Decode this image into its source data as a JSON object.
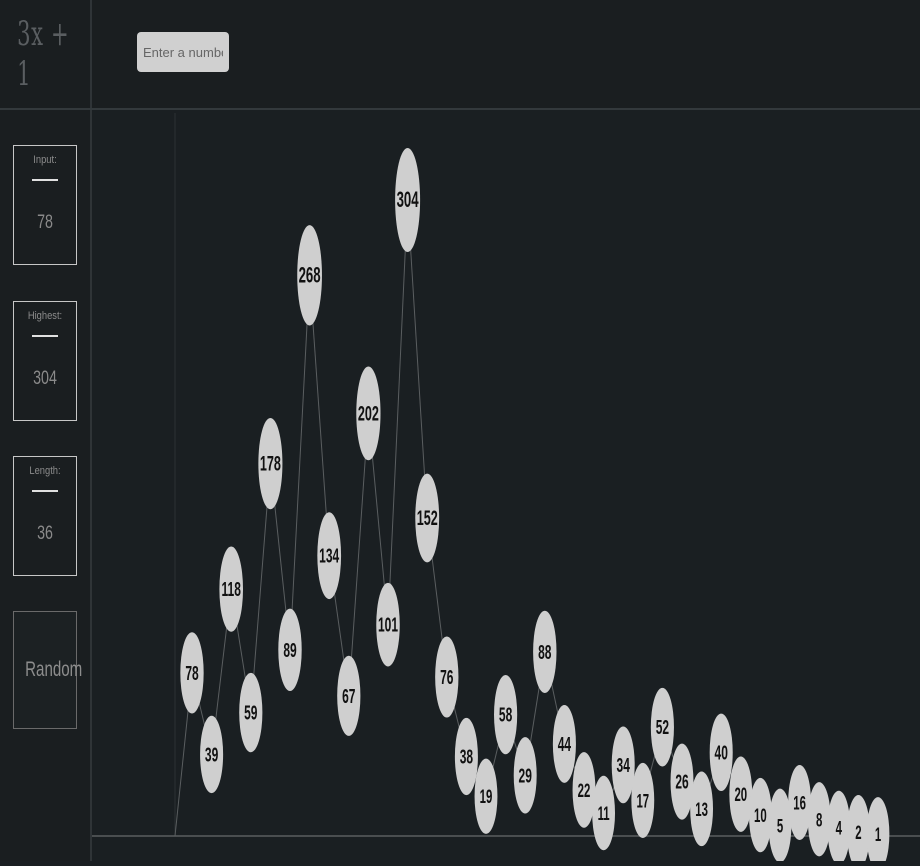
{
  "app": {
    "title": "3x + 1"
  },
  "search": {
    "placeholder": "Enter a number..."
  },
  "stats": {
    "input": {
      "label": "Input:",
      "value": "78"
    },
    "highest": {
      "label": "Highest:",
      "value": "304"
    },
    "length": {
      "label": "Length:",
      "value": "36"
    }
  },
  "random_button": {
    "label": "Random"
  },
  "colors": {
    "background": "#1a1f22",
    "node": "#cfcfcf",
    "node_text": "#111111",
    "edge": "#5a5e60"
  },
  "chart_data": {
    "type": "line",
    "title": "",
    "xlabel": "",
    "ylabel": "",
    "x": [
      1,
      2,
      3,
      4,
      5,
      6,
      7,
      8,
      9,
      10,
      11,
      12,
      13,
      14,
      15,
      16,
      17,
      18,
      19,
      20,
      21,
      22,
      23,
      24,
      25,
      26,
      27,
      28,
      29,
      30,
      31,
      32,
      33,
      34,
      35,
      36
    ],
    "values": [
      78,
      39,
      118,
      59,
      178,
      89,
      268,
      134,
      67,
      202,
      101,
      304,
      152,
      76,
      38,
      19,
      58,
      29,
      88,
      44,
      22,
      11,
      34,
      17,
      52,
      26,
      13,
      40,
      20,
      10,
      5,
      16,
      8,
      4,
      2,
      1
    ],
    "labels": [
      "78",
      "39",
      "118",
      "59",
      "178",
      "89",
      "268",
      "134",
      "67",
      "202",
      "101",
      "304",
      "152",
      "76",
      "38",
      "19",
      "58",
      "29",
      "88",
      "44",
      "22",
      "11",
      "34",
      "17",
      "52",
      "26",
      "13",
      "40",
      "20",
      "10",
      "5",
      "16",
      "8",
      "4",
      "2",
      "1"
    ],
    "ylim": [
      0,
      330
    ],
    "grid": false,
    "legend": "none"
  }
}
